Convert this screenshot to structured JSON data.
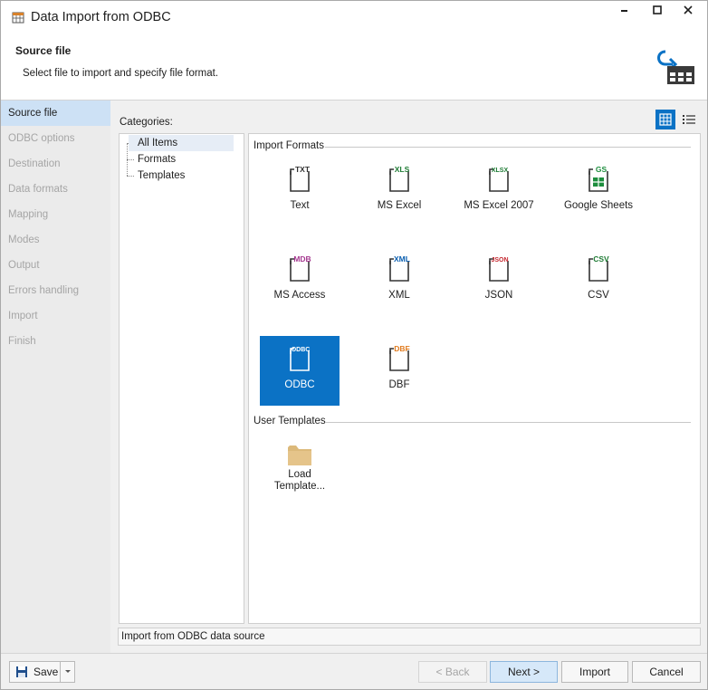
{
  "window": {
    "title": "Data Import from ODBC",
    "controls": {
      "minimize": "–",
      "maximize": "☐",
      "close": "✕"
    }
  },
  "header": {
    "title": "Source file",
    "subtitle": "Select file to import and specify file format."
  },
  "nav": {
    "items": [
      {
        "label": "Source file",
        "active": true
      },
      {
        "label": "ODBC options",
        "active": false
      },
      {
        "label": "Destination",
        "active": false
      },
      {
        "label": "Data formats",
        "active": false
      },
      {
        "label": "Mapping",
        "active": false
      },
      {
        "label": "Modes",
        "active": false
      },
      {
        "label": "Output",
        "active": false
      },
      {
        "label": "Errors handling",
        "active": false
      },
      {
        "label": "Import",
        "active": false
      },
      {
        "label": "Finish",
        "active": false
      }
    ]
  },
  "categories": {
    "label": "Categories:",
    "tree": [
      {
        "label": "All Items",
        "selected": true
      },
      {
        "label": "Formats",
        "selected": false
      },
      {
        "label": "Templates",
        "selected": false
      }
    ]
  },
  "view_toggle": {
    "grid_icon": "grid-view-icon",
    "list_icon": "list-view-icon"
  },
  "import_formats": {
    "heading": "Import Formats",
    "items": [
      {
        "name": "Text",
        "tag": "TXT",
        "color": "#333333",
        "selected": false
      },
      {
        "name": "MS Excel",
        "tag": "XLS",
        "color": "#1e7b34",
        "selected": false
      },
      {
        "name": "MS Excel 2007",
        "tag": "XLSX",
        "color": "#1e7b34",
        "selected": false
      },
      {
        "name": "Google Sheets",
        "tag": "GS",
        "color": "#1e8e3e",
        "selected": false
      },
      {
        "name": "MS Access",
        "tag": "MDB",
        "color": "#a4378f",
        "selected": false
      },
      {
        "name": "XML",
        "tag": "XML",
        "color": "#0b5fb0",
        "selected": false
      },
      {
        "name": "JSON",
        "tag": "JSON",
        "color": "#c4262e",
        "selected": false
      },
      {
        "name": "CSV",
        "tag": "CSV",
        "color": "#1e7b34",
        "selected": false
      },
      {
        "name": "ODBC",
        "tag": "ODBC",
        "color": "#8a8a2a",
        "selected": true
      },
      {
        "name": "DBF",
        "tag": "DBF",
        "color": "#e07b1e",
        "selected": false
      }
    ]
  },
  "user_templates": {
    "heading": "User Templates",
    "items": [
      {
        "name_line1": "Load",
        "name_line2": "Template..."
      }
    ]
  },
  "status": "Import from ODBC data source",
  "footer": {
    "save": "Save",
    "back": "< Back",
    "next": "Next >",
    "import": "Import",
    "cancel": "Cancel"
  },
  "colors": {
    "accent": "#0b72c5",
    "nav_active": "#cde1f5"
  }
}
